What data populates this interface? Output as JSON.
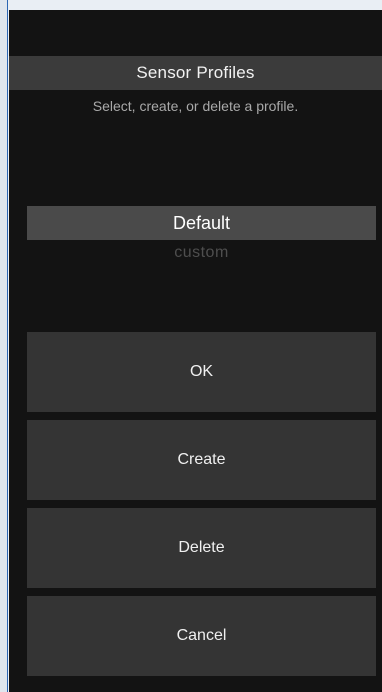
{
  "dialog": {
    "title": "Sensor Profiles",
    "subtitle": "Select, create, or delete a profile."
  },
  "profiles": {
    "selected": "Default",
    "items": [
      "Default",
      "custom"
    ]
  },
  "buttons": {
    "ok": "OK",
    "create": "Create",
    "delete": "Delete",
    "cancel": "Cancel"
  },
  "colors": {
    "background": "#131313",
    "title_bar": "#3b3b3b",
    "selected_row": "#4a4a4a",
    "button": "#343434",
    "frame_edge": "#2c66b3"
  }
}
